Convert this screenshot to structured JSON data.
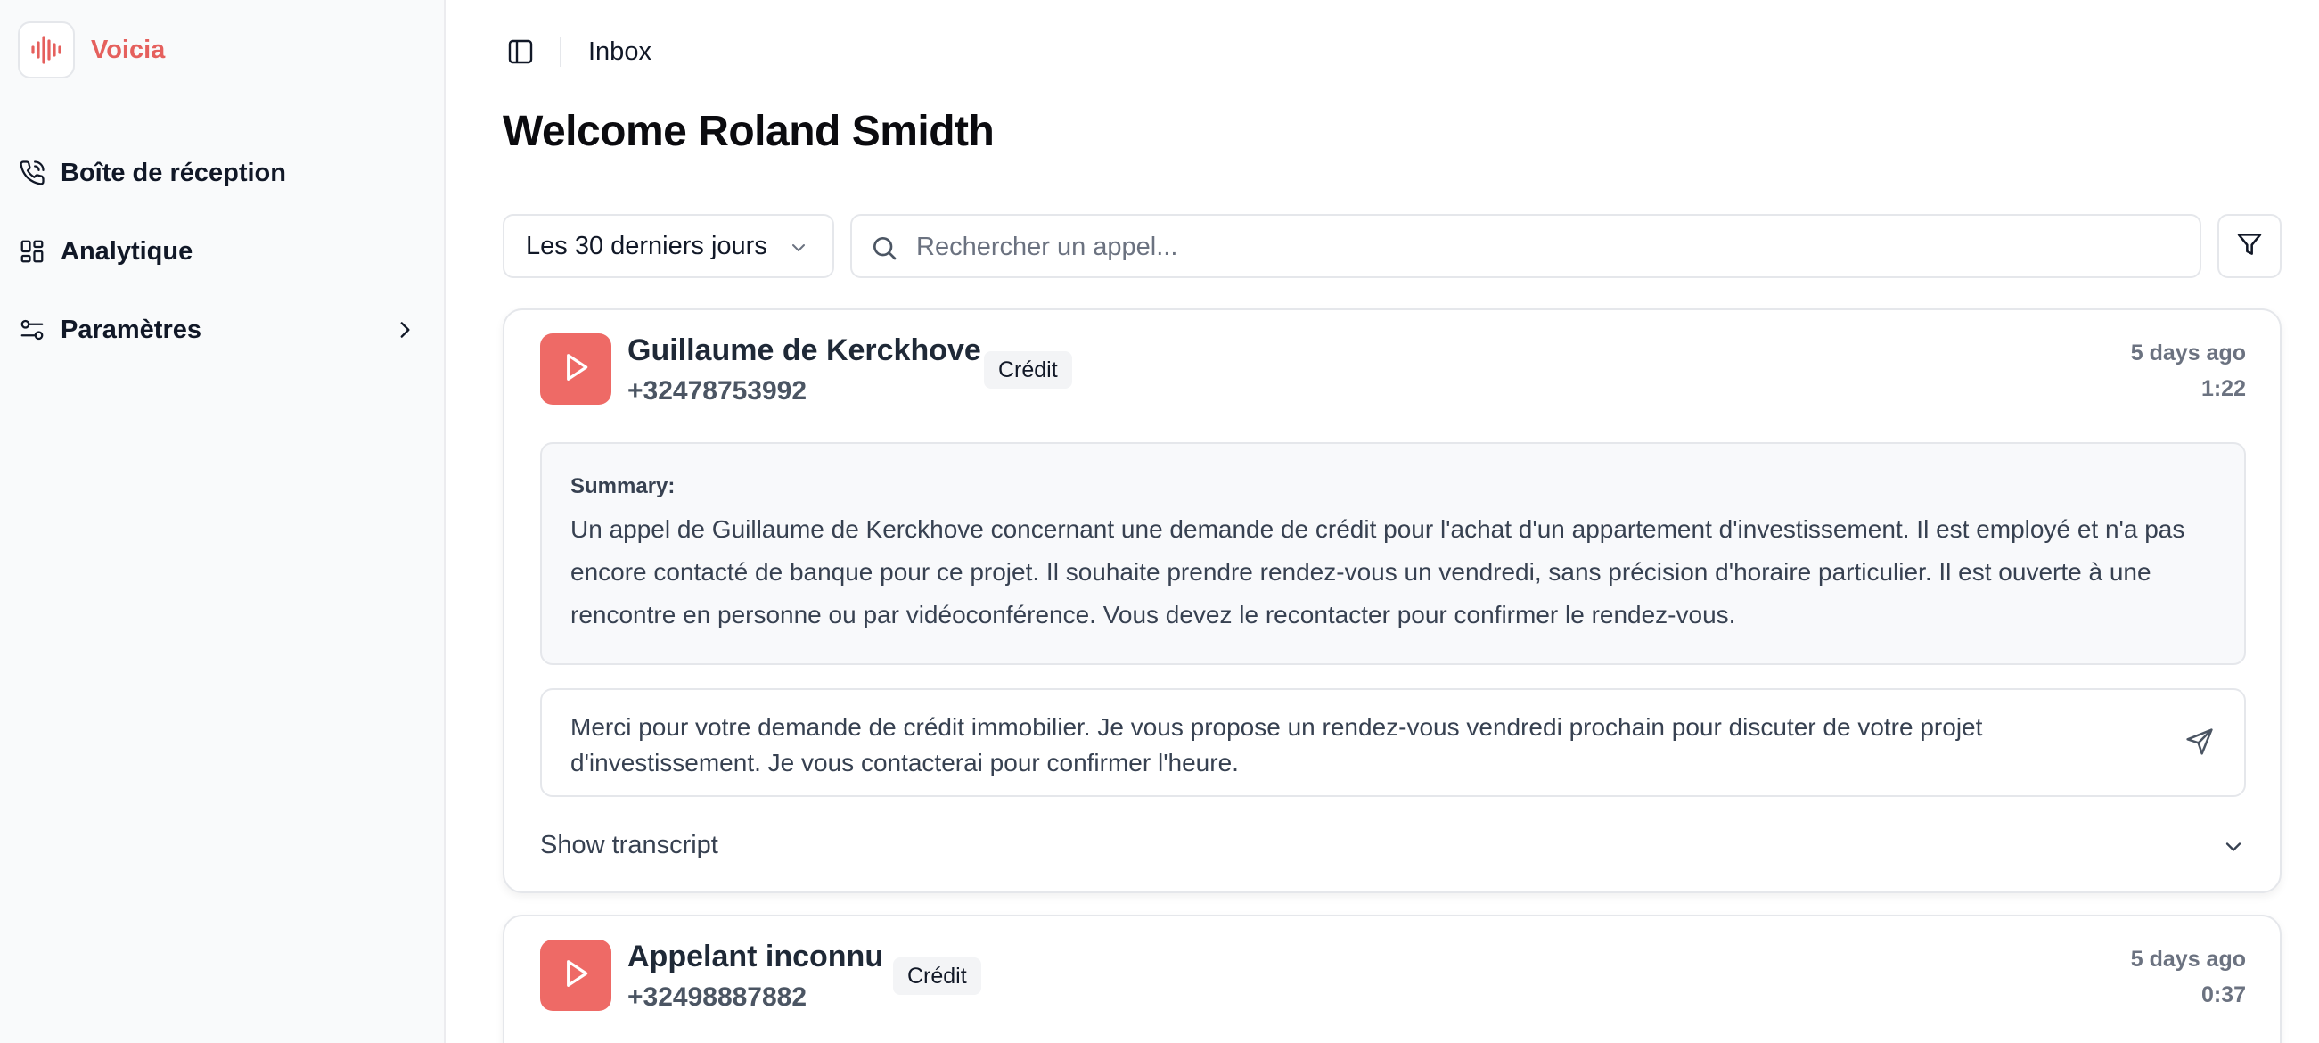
{
  "app": {
    "name": "Voicia",
    "brand_color": "#e5605d",
    "logo_icon": "audio-waveform-icon"
  },
  "sidebar": {
    "items": [
      {
        "label": "Boîte de réception",
        "icon": "phone-call-icon"
      },
      {
        "label": "Analytique",
        "icon": "layout-dashboard-icon"
      },
      {
        "label": "Paramètres",
        "icon": "settings-sliders-icon",
        "has_submenu": true
      }
    ]
  },
  "topbar": {
    "breadcrumb": "Inbox",
    "toggle_icon": "sidebar-toggle-icon"
  },
  "page": {
    "title": "Welcome Roland Smidth"
  },
  "filters": {
    "range_value": "Les 30 derniers jours",
    "search_placeholder": "Rechercher un appel...",
    "search_value": "",
    "filter_icon": "funnel-icon"
  },
  "calls": [
    {
      "name": "Guillaume de Kerckhove",
      "phone": "+32478753992",
      "tag": "Crédit",
      "time_ago": "5 days ago",
      "duration": "1:22",
      "summary_label": "Summary:",
      "summary": "Un appel de Guillaume de Kerckhove concernant une demande de crédit pour l'achat d'un appartement d'investissement. Il est employé et n'a pas encore contacté de banque pour ce projet. Il souhaite prendre rendez-vous un vendredi, sans précision d'horaire particulier. Il est ouverte à une rencontre en personne ou par vidéoconférence. Vous devez le recontacter pour confirmer le rendez-vous.",
      "reply": "Merci pour votre demande de crédit immobilier. Je vous propose un rendez-vous vendredi prochain pour discuter de votre projet d'investissement. Je vous contacterai pour confirmer l'heure.",
      "transcript_toggle": "Show transcript"
    },
    {
      "name": "Appelant inconnu",
      "phone": "+32498887882",
      "tag": "Crédit",
      "time_ago": "5 days ago",
      "duration": "0:37"
    }
  ],
  "colors": {
    "accent": "#ee6a66",
    "border": "#e5e7eb",
    "muted_text": "#6b7280"
  }
}
